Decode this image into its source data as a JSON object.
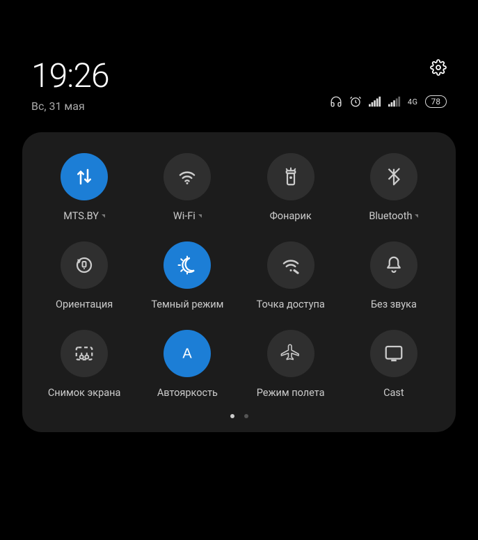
{
  "header": {
    "time": "19:26",
    "date": "Вс, 31 мая",
    "network_type": "4G",
    "battery": "78"
  },
  "tiles": [
    {
      "label": "MTS.BY",
      "expandable": true,
      "active": true,
      "icon": "mobile-data"
    },
    {
      "label": "Wi-Fi",
      "expandable": true,
      "active": false,
      "icon": "wifi"
    },
    {
      "label": "Фонарик",
      "expandable": false,
      "active": false,
      "icon": "flashlight"
    },
    {
      "label": "Bluetooth",
      "expandable": true,
      "active": false,
      "icon": "bluetooth"
    },
    {
      "label": "Ориентация",
      "expandable": false,
      "active": false,
      "icon": "orientation"
    },
    {
      "label": "Темный режим",
      "expandable": false,
      "active": true,
      "icon": "dark-mode"
    },
    {
      "label": "Точка доступа",
      "expandable": false,
      "active": false,
      "icon": "hotspot"
    },
    {
      "label": "Без звука",
      "expandable": false,
      "active": false,
      "icon": "silent"
    },
    {
      "label": "Снимок экрана",
      "expandable": false,
      "active": false,
      "icon": "screenshot"
    },
    {
      "label": "Автояркость",
      "expandable": false,
      "active": true,
      "icon": "auto-brightness"
    },
    {
      "label": "Режим полета",
      "expandable": false,
      "active": false,
      "icon": "airplane"
    },
    {
      "label": "Cast",
      "expandable": false,
      "active": false,
      "icon": "cast"
    }
  ],
  "pager": {
    "current": 0,
    "total": 2
  }
}
